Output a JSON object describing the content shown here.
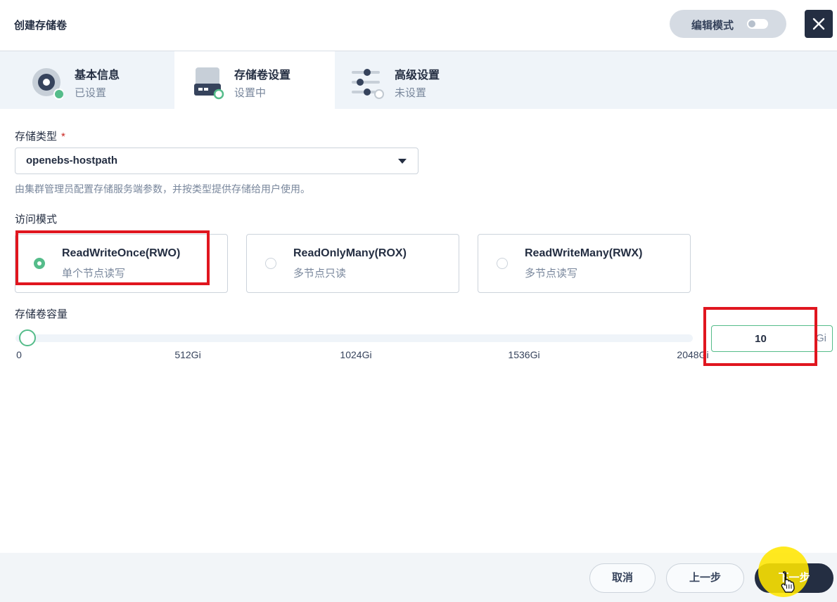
{
  "dialog": {
    "title": "创建存储卷",
    "edit_mode_label": "编辑模式",
    "edit_mode_enabled": false,
    "close_icon": "close-icon"
  },
  "steps": [
    {
      "title": "基本信息",
      "status": "已设置",
      "icon": "disk-icon",
      "state": "done"
    },
    {
      "title": "存储卷设置",
      "status": "设置中",
      "icon": "drive-icon",
      "state": "active"
    },
    {
      "title": "高级设置",
      "status": "未设置",
      "icon": "sliders-icon",
      "state": "pending"
    }
  ],
  "form": {
    "storage_class": {
      "label": "存储类型",
      "required_mark": "*",
      "value": "openebs-hostpath",
      "help": "由集群管理员配置存储服务端参数，并按类型提供存储给用户使用。"
    },
    "access_mode": {
      "label": "访问模式",
      "options": [
        {
          "title": "ReadWriteOnce(RWO)",
          "desc": "单个节点读写",
          "selected": true
        },
        {
          "title": "ReadOnlyMany(ROX)",
          "desc": "多节点只读",
          "selected": false
        },
        {
          "title": "ReadWriteMany(RWX)",
          "desc": "多节点读写",
          "selected": false
        }
      ]
    },
    "capacity": {
      "label": "存储卷容量",
      "value": "10",
      "unit": "Gi",
      "slider_value": 10,
      "slider_max": 2048,
      "ticks": [
        "0",
        "512Gi",
        "1024Gi",
        "1536Gi",
        "2048Gi"
      ]
    }
  },
  "footer": {
    "cancel_label": "取消",
    "prev_label": "上一步",
    "next_label": "下一步"
  },
  "colors": {
    "accent": "#55bc8a",
    "primary_dark": "#242e42",
    "annotation_red": "#e0161f",
    "cursor_highlight": "#ffe600"
  }
}
